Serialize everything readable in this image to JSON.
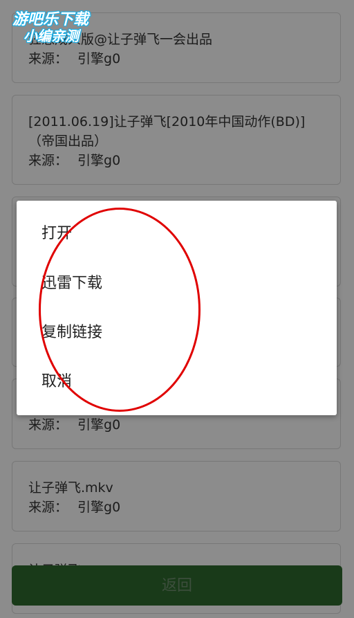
{
  "watermark": {
    "line1": "游吧乐下载",
    "line2": "小编亲测"
  },
  "results": [
    {
      "title": "狂憩成人版@让子弹飞一会出品",
      "source_label": "来源：",
      "source": "引擎g0"
    },
    {
      "title": "[2011.06.19]让子弹飞[2010年中国动作(BD)]（帝国出品）",
      "source_label": "来源：",
      "source": "引擎g0"
    },
    {
      "title": "",
      "source_label": "",
      "source": ""
    },
    {
      "title": "",
      "source_label": "",
      "source": ""
    },
    {
      "title": "",
      "source_label": "来源：",
      "source": "引擎g0"
    },
    {
      "title": "让子弹飞.mkv",
      "source_label": "来源：",
      "source": "引擎g0"
    },
    {
      "title": "让子弹飞",
      "source_label": "",
      "source": ""
    }
  ],
  "dialog": {
    "items": [
      "打开",
      "迅雷下载",
      "复制链接",
      "取消"
    ]
  },
  "back_button": {
    "label": "返回"
  },
  "colors": {
    "button_green": "#2e6b2e",
    "annotation_red": "#e00000",
    "watermark_blue": "#1ab0e8"
  }
}
